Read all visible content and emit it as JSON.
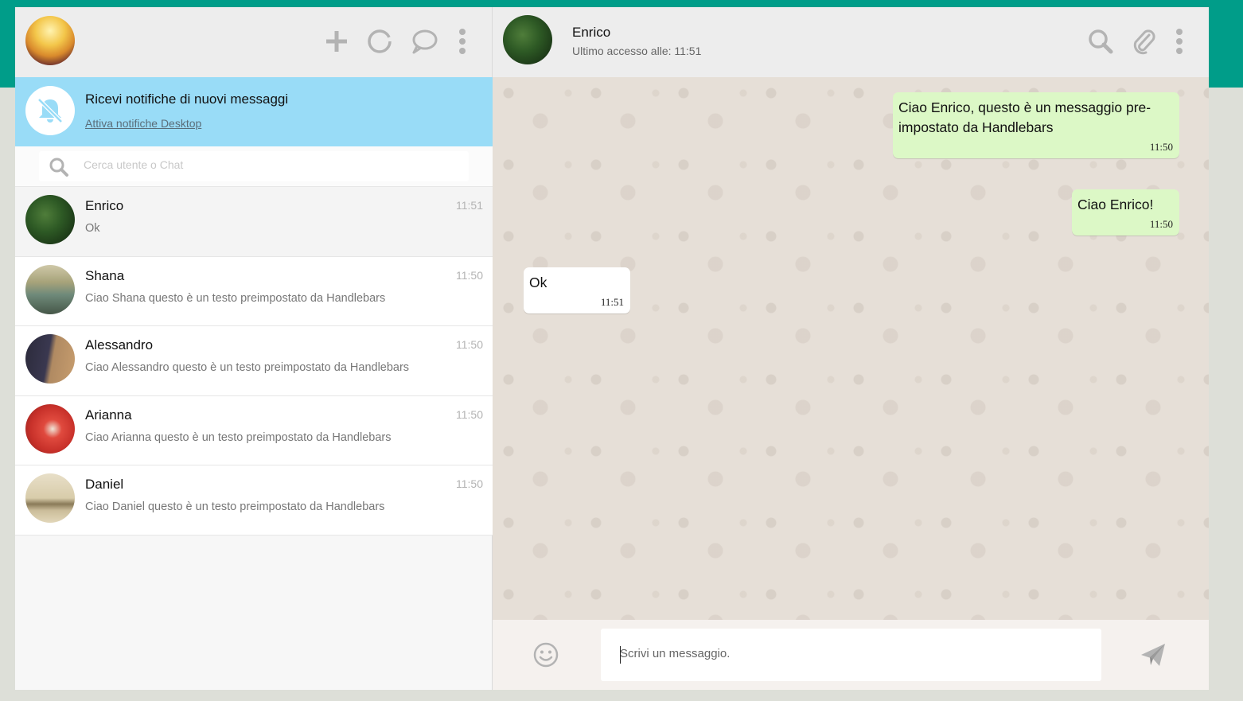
{
  "sidebar": {
    "header": {
      "icons": [
        "plus-icon",
        "status-ring-icon",
        "chat-bubble-icon",
        "menu-dots-icon"
      ]
    },
    "notification": {
      "title": "Ricevi notifiche di nuovi messaggi",
      "link": "Attiva notifiche Desktop"
    },
    "search": {
      "placeholder": "Cerca utente o Chat"
    },
    "chats": [
      {
        "name": "Enrico",
        "preview": "Ok",
        "time": "11:51",
        "active": true
      },
      {
        "name": "Shana",
        "preview": "Ciao Shana questo è un testo preimpostato da Handlebars",
        "time": "11:50"
      },
      {
        "name": "Alessandro",
        "preview": "Ciao Alessandro questo è un testo preimpostato da Handlebars",
        "time": "11:50"
      },
      {
        "name": "Arianna",
        "preview": "Ciao Arianna questo è un testo preimpostato da Handlebars",
        "time": "11:50"
      },
      {
        "name": "Daniel",
        "preview": "Ciao Daniel questo è un testo preimpostato da Handlebars",
        "time": "11:50"
      }
    ]
  },
  "chat": {
    "header": {
      "name": "Enrico",
      "status": "Ultimo accesso alle: 11:51",
      "icons": [
        "search-icon",
        "paperclip-icon",
        "menu-dots-icon"
      ]
    },
    "messages": [
      {
        "direction": "out",
        "text": "Ciao Enrico, questo è un messaggio pre-impostato da Handlebars",
        "time": "11:50"
      },
      {
        "direction": "out",
        "text": "Ciao Enrico!",
        "time": "11:50"
      },
      {
        "direction": "in",
        "text": "Ok",
        "time": "11:51"
      }
    ],
    "composer": {
      "placeholder": "Scrivi un messaggio."
    }
  },
  "colors": {
    "brand_band": "#009d89",
    "notification_bg": "#99dcf7",
    "outgoing_bubble": "#dcf8c6",
    "incoming_bubble": "#ffffff",
    "icon_gray": "#b3b3b3"
  }
}
